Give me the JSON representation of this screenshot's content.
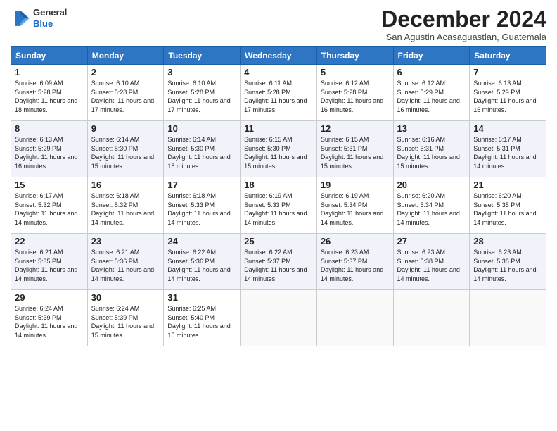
{
  "header": {
    "logo_general": "General",
    "logo_blue": "Blue",
    "month_title": "December 2024",
    "location": "San Agustin Acasaguastlan, Guatemala"
  },
  "days_of_week": [
    "Sunday",
    "Monday",
    "Tuesday",
    "Wednesday",
    "Thursday",
    "Friday",
    "Saturday"
  ],
  "weeks": [
    [
      {
        "day": "1",
        "sunrise": "Sunrise: 6:09 AM",
        "sunset": "Sunset: 5:28 PM",
        "daylight": "Daylight: 11 hours and 18 minutes."
      },
      {
        "day": "2",
        "sunrise": "Sunrise: 6:10 AM",
        "sunset": "Sunset: 5:28 PM",
        "daylight": "Daylight: 11 hours and 17 minutes."
      },
      {
        "day": "3",
        "sunrise": "Sunrise: 6:10 AM",
        "sunset": "Sunset: 5:28 PM",
        "daylight": "Daylight: 11 hours and 17 minutes."
      },
      {
        "day": "4",
        "sunrise": "Sunrise: 6:11 AM",
        "sunset": "Sunset: 5:28 PM",
        "daylight": "Daylight: 11 hours and 17 minutes."
      },
      {
        "day": "5",
        "sunrise": "Sunrise: 6:12 AM",
        "sunset": "Sunset: 5:28 PM",
        "daylight": "Daylight: 11 hours and 16 minutes."
      },
      {
        "day": "6",
        "sunrise": "Sunrise: 6:12 AM",
        "sunset": "Sunset: 5:29 PM",
        "daylight": "Daylight: 11 hours and 16 minutes."
      },
      {
        "day": "7",
        "sunrise": "Sunrise: 6:13 AM",
        "sunset": "Sunset: 5:29 PM",
        "daylight": "Daylight: 11 hours and 16 minutes."
      }
    ],
    [
      {
        "day": "8",
        "sunrise": "Sunrise: 6:13 AM",
        "sunset": "Sunset: 5:29 PM",
        "daylight": "Daylight: 11 hours and 16 minutes."
      },
      {
        "day": "9",
        "sunrise": "Sunrise: 6:14 AM",
        "sunset": "Sunset: 5:30 PM",
        "daylight": "Daylight: 11 hours and 15 minutes."
      },
      {
        "day": "10",
        "sunrise": "Sunrise: 6:14 AM",
        "sunset": "Sunset: 5:30 PM",
        "daylight": "Daylight: 11 hours and 15 minutes."
      },
      {
        "day": "11",
        "sunrise": "Sunrise: 6:15 AM",
        "sunset": "Sunset: 5:30 PM",
        "daylight": "Daylight: 11 hours and 15 minutes."
      },
      {
        "day": "12",
        "sunrise": "Sunrise: 6:15 AM",
        "sunset": "Sunset: 5:31 PM",
        "daylight": "Daylight: 11 hours and 15 minutes."
      },
      {
        "day": "13",
        "sunrise": "Sunrise: 6:16 AM",
        "sunset": "Sunset: 5:31 PM",
        "daylight": "Daylight: 11 hours and 15 minutes."
      },
      {
        "day": "14",
        "sunrise": "Sunrise: 6:17 AM",
        "sunset": "Sunset: 5:31 PM",
        "daylight": "Daylight: 11 hours and 14 minutes."
      }
    ],
    [
      {
        "day": "15",
        "sunrise": "Sunrise: 6:17 AM",
        "sunset": "Sunset: 5:32 PM",
        "daylight": "Daylight: 11 hours and 14 minutes."
      },
      {
        "day": "16",
        "sunrise": "Sunrise: 6:18 AM",
        "sunset": "Sunset: 5:32 PM",
        "daylight": "Daylight: 11 hours and 14 minutes."
      },
      {
        "day": "17",
        "sunrise": "Sunrise: 6:18 AM",
        "sunset": "Sunset: 5:33 PM",
        "daylight": "Daylight: 11 hours and 14 minutes."
      },
      {
        "day": "18",
        "sunrise": "Sunrise: 6:19 AM",
        "sunset": "Sunset: 5:33 PM",
        "daylight": "Daylight: 11 hours and 14 minutes."
      },
      {
        "day": "19",
        "sunrise": "Sunrise: 6:19 AM",
        "sunset": "Sunset: 5:34 PM",
        "daylight": "Daylight: 11 hours and 14 minutes."
      },
      {
        "day": "20",
        "sunrise": "Sunrise: 6:20 AM",
        "sunset": "Sunset: 5:34 PM",
        "daylight": "Daylight: 11 hours and 14 minutes."
      },
      {
        "day": "21",
        "sunrise": "Sunrise: 6:20 AM",
        "sunset": "Sunset: 5:35 PM",
        "daylight": "Daylight: 11 hours and 14 minutes."
      }
    ],
    [
      {
        "day": "22",
        "sunrise": "Sunrise: 6:21 AM",
        "sunset": "Sunset: 5:35 PM",
        "daylight": "Daylight: 11 hours and 14 minutes."
      },
      {
        "day": "23",
        "sunrise": "Sunrise: 6:21 AM",
        "sunset": "Sunset: 5:36 PM",
        "daylight": "Daylight: 11 hours and 14 minutes."
      },
      {
        "day": "24",
        "sunrise": "Sunrise: 6:22 AM",
        "sunset": "Sunset: 5:36 PM",
        "daylight": "Daylight: 11 hours and 14 minutes."
      },
      {
        "day": "25",
        "sunrise": "Sunrise: 6:22 AM",
        "sunset": "Sunset: 5:37 PM",
        "daylight": "Daylight: 11 hours and 14 minutes."
      },
      {
        "day": "26",
        "sunrise": "Sunrise: 6:23 AM",
        "sunset": "Sunset: 5:37 PM",
        "daylight": "Daylight: 11 hours and 14 minutes."
      },
      {
        "day": "27",
        "sunrise": "Sunrise: 6:23 AM",
        "sunset": "Sunset: 5:38 PM",
        "daylight": "Daylight: 11 hours and 14 minutes."
      },
      {
        "day": "28",
        "sunrise": "Sunrise: 6:23 AM",
        "sunset": "Sunset: 5:38 PM",
        "daylight": "Daylight: 11 hours and 14 minutes."
      }
    ],
    [
      {
        "day": "29",
        "sunrise": "Sunrise: 6:24 AM",
        "sunset": "Sunset: 5:39 PM",
        "daylight": "Daylight: 11 hours and 14 minutes."
      },
      {
        "day": "30",
        "sunrise": "Sunrise: 6:24 AM",
        "sunset": "Sunset: 5:39 PM",
        "daylight": "Daylight: 11 hours and 15 minutes."
      },
      {
        "day": "31",
        "sunrise": "Sunrise: 6:25 AM",
        "sunset": "Sunset: 5:40 PM",
        "daylight": "Daylight: 11 hours and 15 minutes."
      },
      null,
      null,
      null,
      null
    ]
  ]
}
